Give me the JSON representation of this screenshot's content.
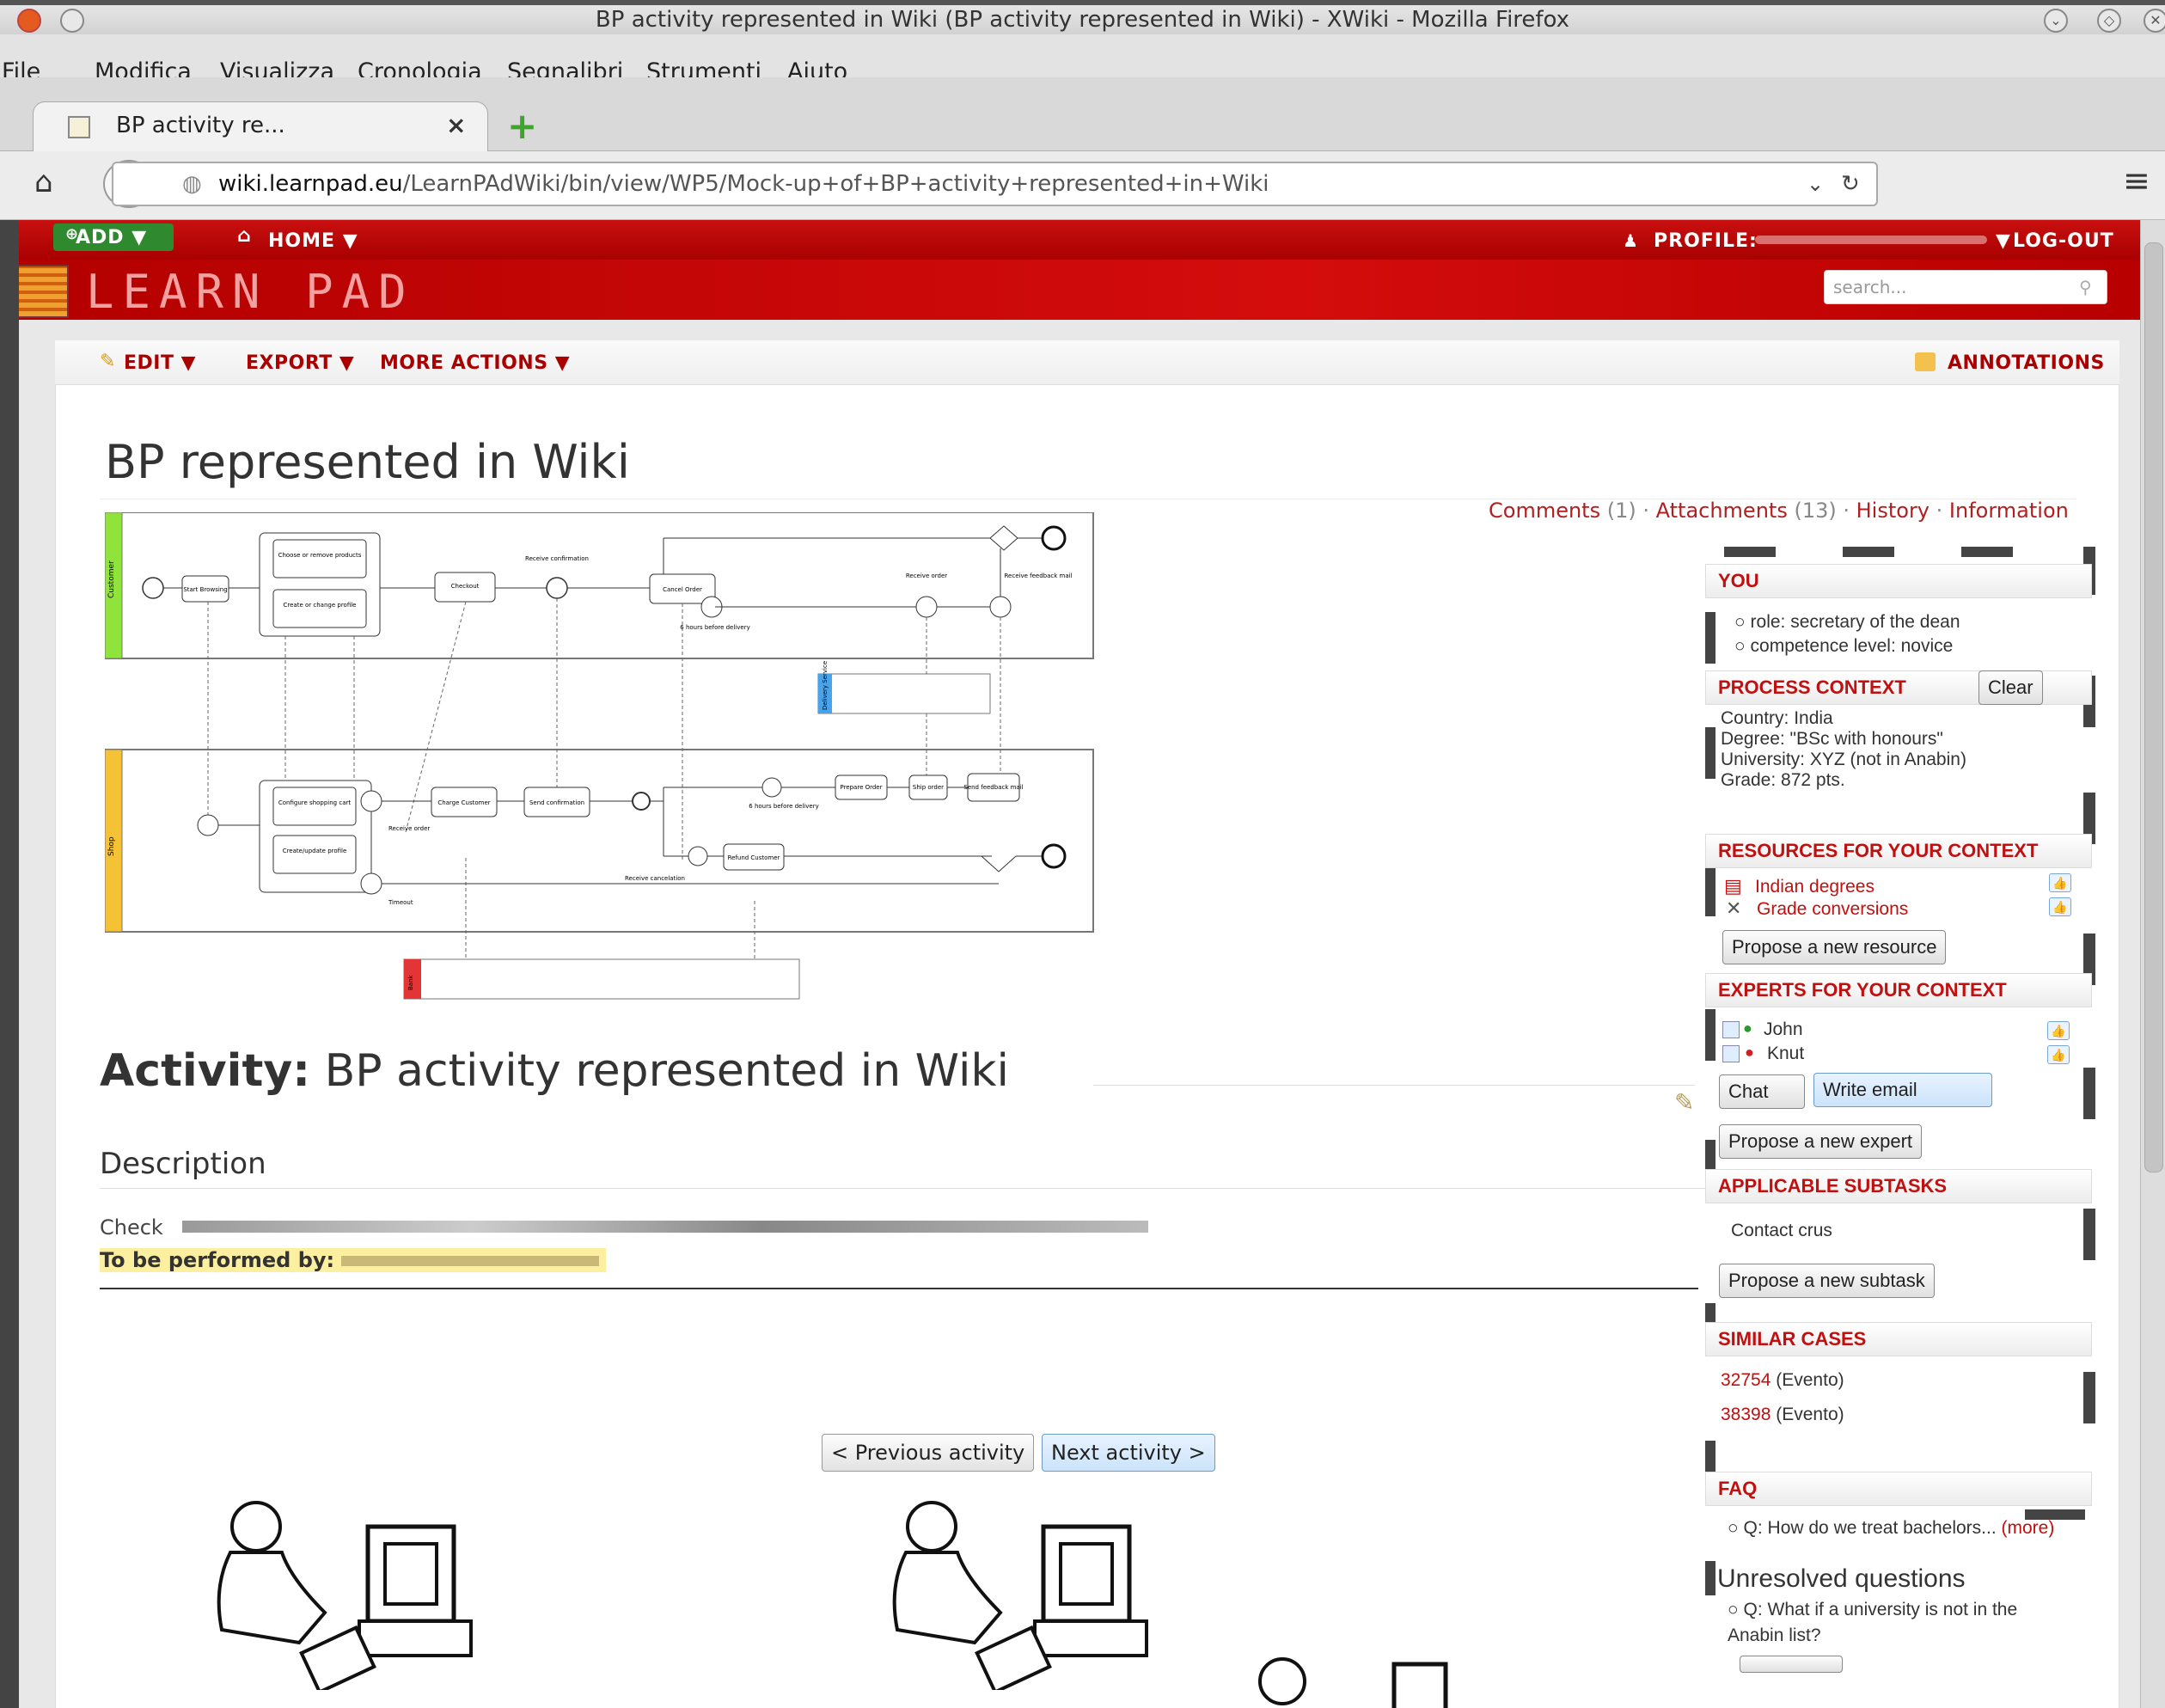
{
  "window": {
    "title": "BP activity represented in Wiki (BP activity represented in Wiki) - XWiki - Mozilla Firefox"
  },
  "menubar": {
    "items": [
      "File",
      "Modifica",
      "Visualizza",
      "Cronologia",
      "Segnalibri",
      "Strumenti",
      "Aiuto"
    ]
  },
  "tab": {
    "label": "BP activity re..."
  },
  "urlbar": {
    "host": "wiki.learnpad.eu",
    "path": "/LearnPAdWiki/bin/view/WP5/Mock-up+of+BP+activity+represented+in+Wiki"
  },
  "topnav": {
    "add": "ADD ▼",
    "home": "HOME ▼",
    "profile": "PROFILE:",
    "profile_arrow": "▼",
    "logout": "LOG-OUT"
  },
  "brand": {
    "logo_text": "LEARN PAD",
    "search_placeholder": "search..."
  },
  "actions": {
    "edit": "EDIT ▼",
    "export": "EXPORT ▼",
    "more": "MORE ACTIONS ▼",
    "annotations": "ANNOTATIONS"
  },
  "page": {
    "title": "BP represented in Wiki",
    "links": {
      "comments": "Comments",
      "comments_count": "(1)",
      "attachments": "Attachments",
      "attachments_count": "(13)",
      "history": "History",
      "information": "Information"
    }
  },
  "diagram": {
    "lanes": [
      "Customer",
      "Shop"
    ],
    "pools": [
      "Delivery Service",
      "Bank"
    ],
    "tasks": [
      "Start Browsing",
      "Choose or remove products",
      "Create or change profile",
      "Checkout",
      "Receive confirmation",
      "Cancel Order",
      "Receive order",
      "Receive feedback mail",
      "6 hours before delivery",
      "Configure shopping cart",
      "Create/update profile",
      "Receive order",
      "Charge Customer",
      "Send confirmation",
      "6 hours before delivery",
      "Prepare Order",
      "Ship order",
      "Send feedback mail",
      "Receive cancelation",
      "Refund Customer",
      "Timeout"
    ]
  },
  "activity": {
    "label": "Activity:",
    "name": "BP activity represented in Wiki",
    "description_heading": "Description",
    "description_text": "Check",
    "performed_by": "To be performed by:"
  },
  "navigation": {
    "previous": "< Previous activity",
    "next": "Next activity >"
  },
  "sidebar": {
    "you": {
      "title": "YOU",
      "items": [
        "role: secretary of the dean",
        "competence level: novice"
      ]
    },
    "process_context": {
      "title": "PROCESS CONTEXT",
      "clear": "Clear",
      "lines": [
        "Country: India",
        "Degree: \"BSc with honours\"",
        "University: XYZ (not in Anabin)",
        "Grade: 872 pts."
      ]
    },
    "resources": {
      "title": "RESOURCES FOR YOUR CONTEXT",
      "items": [
        "Indian degrees",
        "Grade conversions"
      ],
      "propose": "Propose a new resource"
    },
    "experts": {
      "title": "EXPERTS FOR YOUR CONTEXT",
      "items": [
        "John",
        "Knut"
      ],
      "chat": "Chat",
      "email": "Write email",
      "propose": "Propose a new expert"
    },
    "subtasks": {
      "title": "APPLICABLE SUBTASKS",
      "items": [
        "Contact crus"
      ],
      "propose": "Propose a new subtask"
    },
    "similar": {
      "title": "SIMILAR CASES",
      "items": [
        {
          "id": "32754",
          "type": "(Evento)"
        },
        {
          "id": "38398",
          "type": "(Evento)"
        }
      ]
    },
    "faq": {
      "title": "FAQ",
      "question": "Q: How do we treat bachelors...",
      "more": "(more)",
      "unresolved_heading": "Unresolved questions",
      "unresolved": "Q: What if a university is not in the Anabin list?"
    }
  },
  "colors": {
    "brand_red": "#b40000",
    "link_red": "#c01010",
    "highlight": "#fcefa0",
    "lane_customer": "#8fe33a",
    "lane_shop": "#f6c235"
  }
}
